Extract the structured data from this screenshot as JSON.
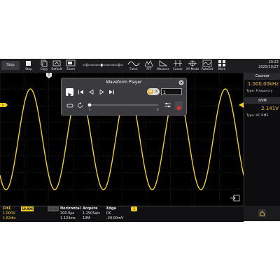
{
  "toolbar": {
    "run_state": "Stop",
    "items": [
      {
        "label": "Stop",
        "icon": "stop-icon"
      },
      {
        "label": "Copy",
        "icon": "copy-icon"
      },
      {
        "label": "Default",
        "icon": "default-icon"
      },
      {
        "label": "Zoom",
        "icon": "zoom-icon"
      },
      {
        "label": "Force",
        "icon": "force-icon"
      },
      {
        "label": "FFT",
        "icon": "fft-icon"
      },
      {
        "label": "Measure",
        "icon": "measure-icon"
      },
      {
        "label": "Cursor",
        "icon": "cursor-icon"
      },
      {
        "label": "XY Mode",
        "icon": "xy-mode-icon"
      },
      {
        "label": "AutoSet",
        "icon": "autoset-icon"
      },
      {
        "label": "More",
        "icon": "more-icon"
      }
    ],
    "time": "20:23",
    "date": "2025/10/27"
  },
  "trigger_marker": "T",
  "channel_marker": "1",
  "side_panel": {
    "counter": {
      "header": "Counter",
      "value": "1.000,00kHz",
      "type": "Type: Frequency"
    },
    "dvm": {
      "header": "DVM",
      "value": "2.141V",
      "type": "Type: AC RMS"
    }
  },
  "player": {
    "title": "Waveform Player",
    "mx_label": "M",
    "x_label": "X",
    "count": "1",
    "slider_start": "1",
    "slider_end": "2"
  },
  "status": {
    "ch1": {
      "name": "CH1",
      "probe": "10.00X",
      "scale": "1.000V",
      "offset": "1.62div"
    },
    "ch2": {
      "name": "",
      "probe": "10.00X"
    },
    "horizontal": {
      "name": "Horizontal",
      "scale": "200.0μs",
      "offset": "1.124ms"
    },
    "acquire": {
      "name": "Acquire",
      "rate": "1.250Sa/s",
      "depth": "10M"
    },
    "trigger": {
      "name": "Edge",
      "badge": "1",
      "coupling": "DC",
      "level": "-20.00mV"
    }
  },
  "colors": {
    "ch1": "#f2d021",
    "accent": "#f0c040",
    "record": "#d93030",
    "play": "#ffffff",
    "mx": "#e6b23a"
  }
}
